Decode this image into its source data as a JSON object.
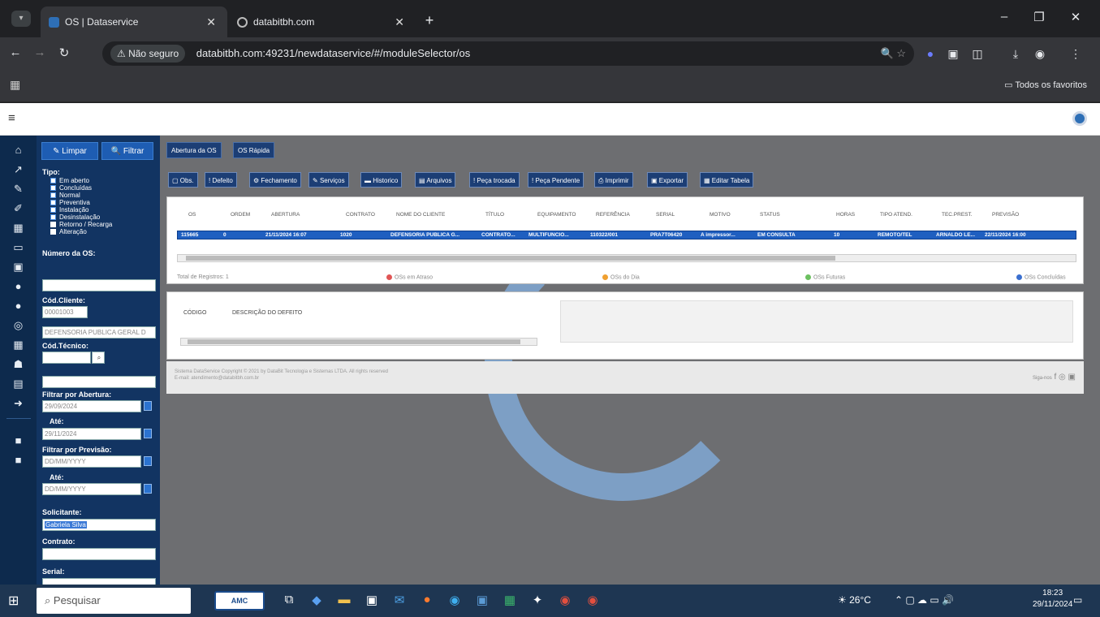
{
  "browser": {
    "tabs": [
      {
        "title": "OS | Dataservice",
        "active": true
      },
      {
        "title": "databitbh.com",
        "active": false
      }
    ],
    "address": {
      "security": "Não seguro",
      "url": "databitbh.com:49231/newdataservice/#/moduleSelector/os"
    },
    "bookmarks_all": "Todos os favoritos"
  },
  "filter_panel": {
    "clear_label": "Limpar",
    "filter_label": "Filtrar",
    "type_label": "Tipo:",
    "types": [
      "Em aberto",
      "Concluídas",
      "Normal",
      "Preventiva",
      "Instalação",
      "Desinstalação",
      "Retorno / Recarga",
      "Alteração"
    ],
    "os_number_label": "Número da OS:",
    "os_number_value": "",
    "client_code_label": "Cód.Cliente:",
    "client_code_value": "00001003",
    "client_name_value": "DEFENSORIA PUBLICA GERAL D",
    "tech_code_label": "Cód.Técnico:",
    "opening_filter_label": "Filtrar por Abertura:",
    "opening_from": "29/09/2024",
    "until_label": "Até:",
    "opening_to": "29/11/2024",
    "forecast_filter_label": "Filtrar por Previsão:",
    "forecast_placeholder": "DD/MM/YYYY",
    "requester_label": "Solicitante:",
    "requester_value": "Gabriela Silva",
    "contact_label": "Contrato:",
    "serial_label": "Serial:"
  },
  "top_tabs": [
    "Abertura da OS",
    "OS Rápida"
  ],
  "toolbar": [
    "Obs.",
    "Defeito",
    "Fechamento",
    "Serviços",
    "Historico",
    "Arquivos",
    "Peça trocada",
    "Peça Pendente",
    "Imprimir",
    "Exportar",
    "Editar Tabela"
  ],
  "grid": {
    "columns": [
      "OS",
      "ORDEM",
      "ABERTURA",
      "CONTRATO",
      "NOME DO CLIENTE",
      "TÍTULO",
      "EQUIPAMENTO",
      "REFERÊNCIA",
      "SERIAL",
      "MOTIVO",
      "STATUS",
      "HORAS",
      "TIPO ATEND.",
      "TEC.PREST.",
      "PREVISÃO"
    ],
    "row": [
      "115665",
      "0",
      "21/11/2024 16:07",
      "1020",
      "DEFENSORIA PUBLICA G...",
      "CONTRATO...",
      "MULTIFUNCIO...",
      "110322/001",
      "PRA7T06420",
      "A impressor...",
      "EM CONSULTA",
      "10",
      "REMOTO/TEL",
      "ARNALDO LE...",
      "22/11/2024 16:00"
    ],
    "total_label": "Total de Registros: 1",
    "legend": [
      "OSs em Atraso",
      "OSs do Dia",
      "OSs Futuras",
      "OSs Concluídas"
    ],
    "legend_colors": [
      "#e05555",
      "#f0a030",
      "#6cc060",
      "#3a6fcf"
    ]
  },
  "detail": {
    "columns": [
      "CÓDIGO",
      "DESCRIÇÃO DO DEFEITO"
    ]
  },
  "footer": {
    "line1": "Sistema DataService Copyright © 2021 by DataBit Tecnologia e Sistemas LTDA. All rights reserved",
    "line2": "E-mail: atendimento@databitbh.com.br",
    "social": "Siga-nos"
  },
  "taskbar": {
    "search": "Pesquisar",
    "amc_label": "AMC",
    "temp": "26°C",
    "time": "18:23",
    "date": "29/11/2024"
  },
  "colors": {
    "rail": "#0d2a4d",
    "panel": "#123462",
    "selected_row": "#1f5fc0",
    "background": "#6d6e71"
  }
}
